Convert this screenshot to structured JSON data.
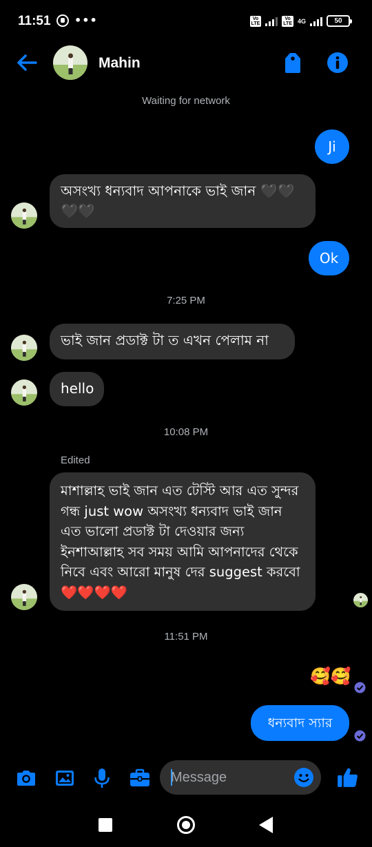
{
  "status_bar": {
    "time": "11:51",
    "dots": "•••",
    "volte_label": "Vo\nLTE",
    "network": "4G",
    "battery": "50"
  },
  "header": {
    "contact_name": "Mahin",
    "accent_color": "#0a7cff"
  },
  "network_status": "Waiting for network",
  "messages": [
    {
      "dir": "out",
      "text": "Ji"
    },
    {
      "dir": "in",
      "text": "অসংখ্য ধন্যবাদ আপনাকে ভাই জান 🖤🖤🖤🖤"
    },
    {
      "dir": "out",
      "text": "Ok"
    },
    {
      "dir": "separator",
      "text": "7:25 PM"
    },
    {
      "dir": "in",
      "text": "ভাই জান প্রডাক্ট টা ত এখন পেলাম না"
    },
    {
      "dir": "in",
      "text": "hello"
    },
    {
      "dir": "separator",
      "text": "10:08 PM"
    },
    {
      "dir": "edited",
      "text": "Edited"
    },
    {
      "dir": "in",
      "text": "মাশাল্লাহ ভাই জান এত টেস্টি আর এত সুন্দর গন্ধ just wow অসংখ্য ধন্যবাদ ভাই জান এত ভালো প্রডাক্ট টা দেওয়ার জন্য ইনশাআল্লাহ সব সময় আমি আপনাদের থেকে নিবে এবং আরো মানুষ দের suggest করবো ❤️❤️❤️❤️"
    },
    {
      "dir": "separator",
      "text": "11:51 PM"
    },
    {
      "dir": "out-emoji",
      "text": "🥰🥰"
    },
    {
      "dir": "out",
      "text": "ধন্যবাদ স্যার"
    }
  ],
  "composer": {
    "placeholder": "Message",
    "icons": [
      "camera-icon",
      "gallery-icon",
      "microphone-icon",
      "briefcase-icon",
      "emoji-icon",
      "like-icon"
    ]
  },
  "nav_bar": {
    "icons": [
      "recents-icon",
      "home-icon",
      "back-icon"
    ]
  }
}
